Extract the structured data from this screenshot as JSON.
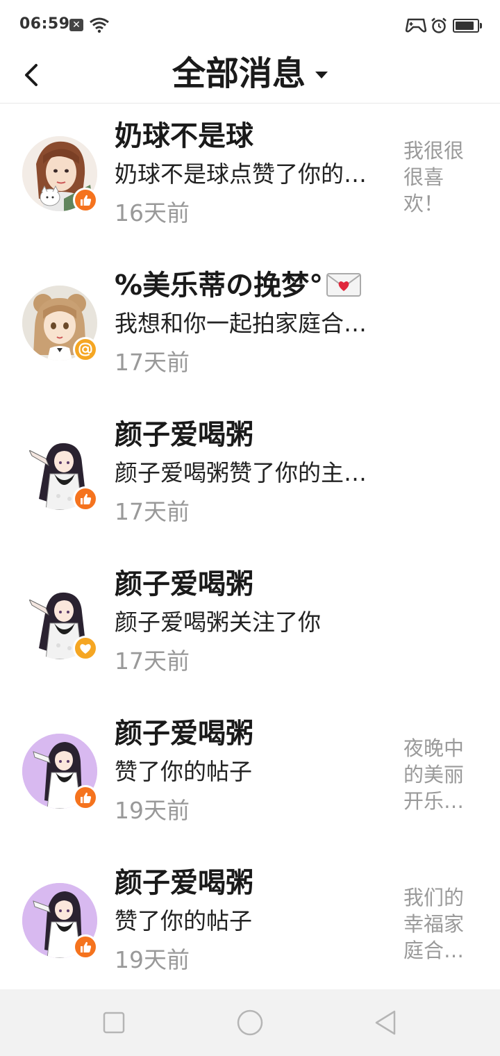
{
  "status_bar": {
    "time": "06:59",
    "icons": [
      "notification-x-icon",
      "wifi-icon",
      "game-controller-icon",
      "alarm-icon",
      "battery-icon"
    ]
  },
  "header": {
    "title": "全部消息",
    "back_icon": "chevron-left-icon",
    "dropdown_icon": "caret-down-icon"
  },
  "colors": {
    "accent": "#F5731E",
    "mention_badge": "#F5A623",
    "text_primary": "#1A1A1A",
    "text_secondary": "#999999",
    "nav_bg": "#F2F2F2"
  },
  "messages": [
    {
      "name": "奶球不是球",
      "text": "奶球不是球点赞了你的…",
      "time": "16天前",
      "preview": "我很很很喜欢！",
      "badge": "thumbs-up-icon"
    },
    {
      "name": "%美乐蒂の挽梦°",
      "name_emoji": "envelope-heart-icon",
      "text": "我想和你一起拍家庭合…",
      "time": "17天前",
      "preview": "",
      "badge": "at-mention-icon"
    },
    {
      "name": "颜子爱喝粥",
      "text": "颜子爱喝粥赞了你的主…",
      "time": "17天前",
      "preview": "",
      "badge": "thumbs-up-icon"
    },
    {
      "name": "颜子爱喝粥",
      "text": "颜子爱喝粥关注了你",
      "time": "17天前",
      "preview": "",
      "badge": "heart-icon"
    },
    {
      "name": "颜子爱喝粥",
      "text": "赞了你的帖子",
      "time": "19天前",
      "preview": "夜晚中的美丽开乐…",
      "badge": "thumbs-up-icon"
    },
    {
      "name": "颜子爱喝粥",
      "text": "赞了你的帖子",
      "time": "19天前",
      "preview": "我们的幸福家庭合…",
      "badge": "thumbs-up-icon"
    }
  ],
  "nav_bar": {
    "icons": [
      "recent-apps-square-icon",
      "home-circle-icon",
      "back-triangle-icon"
    ]
  }
}
